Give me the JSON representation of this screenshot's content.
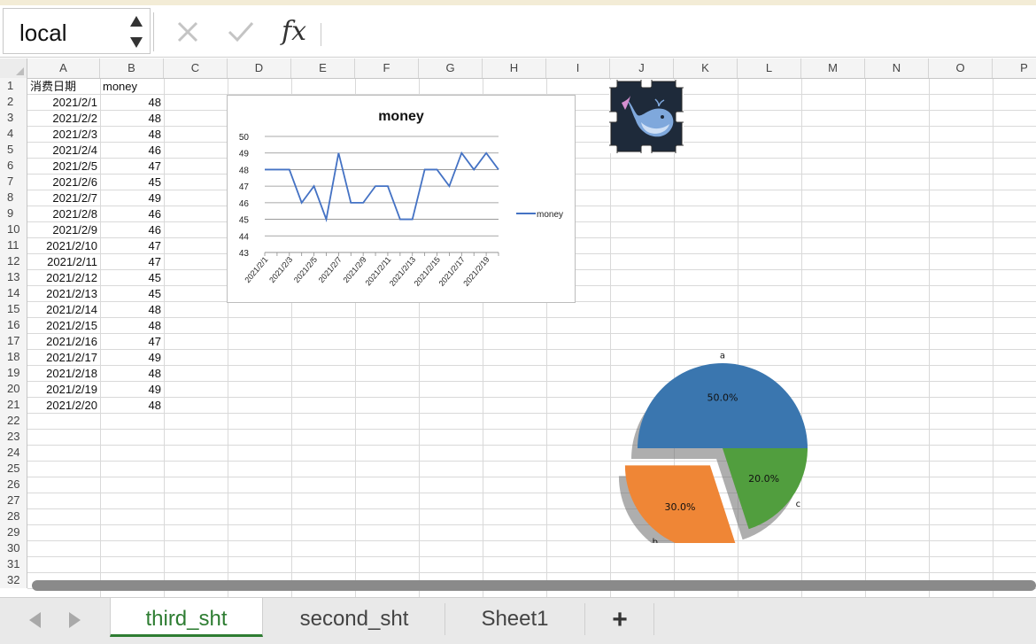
{
  "formula_bar": {
    "name_box": "local",
    "cancel_icon": "close-x-icon",
    "enter_icon": "checkmark-icon",
    "function_label": "fx"
  },
  "columns": [
    "A",
    "B",
    "C",
    "D",
    "E",
    "F",
    "G",
    "H",
    "I",
    "J",
    "K",
    "L",
    "M",
    "N",
    "O",
    "P"
  ],
  "rows": [
    "1",
    "2",
    "3",
    "4",
    "5",
    "6",
    "7",
    "8",
    "9",
    "10",
    "11",
    "12",
    "13",
    "14",
    "15",
    "16",
    "17",
    "18",
    "19",
    "20",
    "21",
    "22",
    "23",
    "24",
    "25",
    "26",
    "27",
    "28",
    "29",
    "30",
    "31",
    "32"
  ],
  "cells": {
    "headers": {
      "a1": "消费日期",
      "b1": "money"
    },
    "records": [
      {
        "date": "2021/2/1",
        "money": "48"
      },
      {
        "date": "2021/2/2",
        "money": "48"
      },
      {
        "date": "2021/2/3",
        "money": "48"
      },
      {
        "date": "2021/2/4",
        "money": "46"
      },
      {
        "date": "2021/2/5",
        "money": "47"
      },
      {
        "date": "2021/2/6",
        "money": "45"
      },
      {
        "date": "2021/2/7",
        "money": "49"
      },
      {
        "date": "2021/2/8",
        "money": "46"
      },
      {
        "date": "2021/2/9",
        "money": "46"
      },
      {
        "date": "2021/2/10",
        "money": "47"
      },
      {
        "date": "2021/2/11",
        "money": "47"
      },
      {
        "date": "2021/2/12",
        "money": "45"
      },
      {
        "date": "2021/2/13",
        "money": "45"
      },
      {
        "date": "2021/2/14",
        "money": "48"
      },
      {
        "date": "2021/2/15",
        "money": "48"
      },
      {
        "date": "2021/2/16",
        "money": "47"
      },
      {
        "date": "2021/2/17",
        "money": "49"
      },
      {
        "date": "2021/2/18",
        "money": "48"
      },
      {
        "date": "2021/2/19",
        "money": "49"
      },
      {
        "date": "2021/2/20",
        "money": "48"
      }
    ]
  },
  "picture": {
    "icon": "whale-logo-icon"
  },
  "chart_data": [
    {
      "type": "line",
      "title": "money",
      "categories": [
        "2021/2/1",
        "2021/2/2",
        "2021/2/3",
        "2021/2/4",
        "2021/2/5",
        "2021/2/6",
        "2021/2/7",
        "2021/2/8",
        "2021/2/9",
        "2021/2/10",
        "2021/2/11",
        "2021/2/12",
        "2021/2/13",
        "2021/2/14",
        "2021/2/15",
        "2021/2/16",
        "2021/2/17",
        "2021/2/18",
        "2021/2/19",
        "2021/2/20"
      ],
      "tick_labels": [
        "2021/2/1",
        "2021/2/3",
        "2021/2/5",
        "2021/2/7",
        "2021/2/9",
        "2021/2/11",
        "2021/2/13",
        "2021/2/15",
        "2021/2/17",
        "2021/2/19"
      ],
      "series": [
        {
          "name": "money",
          "values": [
            48,
            48,
            48,
            46,
            47,
            45,
            49,
            46,
            46,
            47,
            47,
            45,
            45,
            48,
            48,
            47,
            49,
            48,
            49,
            48
          ],
          "color": "#4472c4"
        }
      ],
      "y_ticks": [
        "43",
        "44",
        "45",
        "46",
        "47",
        "48",
        "49",
        "50"
      ],
      "ylim": [
        43,
        50
      ],
      "grid": true,
      "legend": "right"
    },
    {
      "type": "pie",
      "labels": [
        "a",
        "b",
        "c"
      ],
      "values": [
        50,
        30,
        20
      ],
      "value_labels": [
        "50.0%",
        "30.0%",
        "20.0%"
      ],
      "colors": [
        "#3a76af",
        "#ef8636",
        "#519e3e"
      ],
      "explode": "b",
      "shadow": true
    }
  ],
  "tabs": [
    {
      "label": "third_sht",
      "active": true
    },
    {
      "label": "second_sht",
      "active": false
    },
    {
      "label": "Sheet1",
      "active": false
    }
  ],
  "add_tab_label": "+"
}
